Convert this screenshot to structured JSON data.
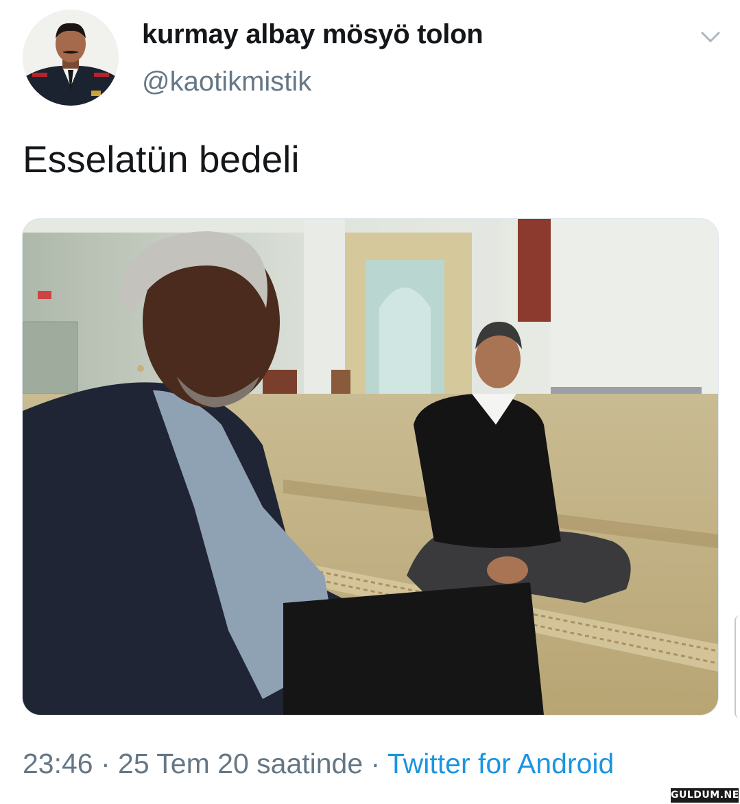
{
  "tweet": {
    "display_name": "kurmay albay mösyö tolon",
    "handle": "@kaotikmistik",
    "text": "Esselatün bedeli",
    "time": "23:46",
    "separator": " · ",
    "date": "25 Tem 20 saatinde",
    "source": "Twitter for Android"
  },
  "icons": {
    "caret": "chevron-down-icon"
  },
  "watermark": {
    "text": "GULDUM.NET"
  },
  "colors": {
    "name": "#14171a",
    "secondary": "#657786",
    "link": "#1b95e0",
    "background": "#ffffff"
  }
}
